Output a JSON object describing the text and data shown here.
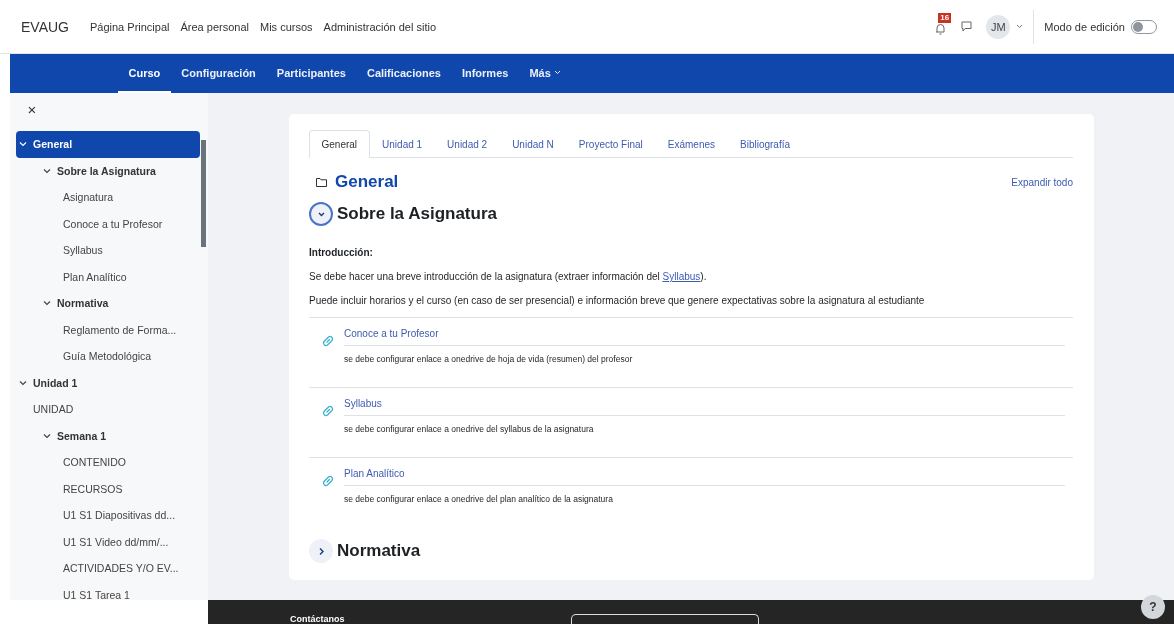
{
  "header": {
    "brand": "EVAUG",
    "links": [
      {
        "label": "Página Principal"
      },
      {
        "label": "Área personal"
      },
      {
        "label": "Mis cursos"
      },
      {
        "label": "Administración del sitio"
      }
    ],
    "notification_count": "16",
    "user_initials": "JM",
    "edit_mode": {
      "label": "Modo de edición",
      "on": false
    }
  },
  "course_nav": {
    "tabs": [
      {
        "label": "Curso",
        "selected": true
      },
      {
        "label": "Configuración",
        "selected": false
      },
      {
        "label": "Participantes",
        "selected": false
      },
      {
        "label": "Calificaciones",
        "selected": false
      },
      {
        "label": "Informes",
        "selected": false
      },
      {
        "label": "Más",
        "selected": false
      }
    ]
  },
  "sidebar": {
    "close": "×",
    "items": [
      {
        "label": "General",
        "selected": true,
        "expanded": true,
        "children": [
          {
            "label": "Sobre la Asignatura",
            "selected": false,
            "expanded": true,
            "children": [
              {
                "label": "Asignatura",
                "selected": false
              },
              {
                "label": "Conoce a tu Profesor",
                "selected": false
              },
              {
                "label": "Syllabus",
                "selected": false
              },
              {
                "label": "Plan Analítico",
                "selected": false
              }
            ]
          },
          {
            "label": "Normativa",
            "selected": false,
            "expanded": true,
            "children": [
              {
                "label": "Reglamento de Forma...",
                "selected": false
              },
              {
                "label": "Guía Metodológica",
                "selected": false
              }
            ]
          }
        ]
      },
      {
        "label": "Unidad 1",
        "selected": false,
        "expanded": true,
        "children": [
          {
            "label": "UNIDAD",
            "selected": false
          },
          {
            "label": "Semana 1",
            "selected": false,
            "expanded": true,
            "children": [
              {
                "label": "CONTENIDO",
                "selected": false
              },
              {
                "label": "RECURSOS",
                "selected": false
              },
              {
                "label": "U1 S1 Diapositivas dd...",
                "selected": false
              },
              {
                "label": "U1 S1 Video dd/mm/...",
                "selected": false
              },
              {
                "label": "ACTIVIDADES Y/O EV...",
                "selected": false
              },
              {
                "label": "U1 S1 Tarea 1",
                "selected": false
              }
            ]
          }
        ]
      }
    ]
  },
  "content": {
    "tabs": [
      {
        "label": "General",
        "selected": true
      },
      {
        "label": "Unidad 1",
        "selected": false
      },
      {
        "label": "Unidad 2",
        "selected": false
      },
      {
        "label": "Unidad N",
        "selected": false
      },
      {
        "label": "Proyecto Final",
        "selected": false
      },
      {
        "label": "Exámenes",
        "selected": false
      },
      {
        "label": "Bibliografía",
        "selected": false
      }
    ],
    "section_title": "General",
    "expand_all": "Expandir todo",
    "subsections": [
      {
        "title": "Sobre la Asignatura",
        "expanded": true,
        "intro_heading": "Introducción:",
        "paragraphs": [
          {
            "before": "Se debe hacer una breve introducción de la asignatura (extraer información del ",
            "link": "Syllabus",
            "after": ")."
          },
          {
            "before": "Puede incluir horarios y el curso (en caso de ser presencial) e información breve que genere expectativas sobre la asignatura al estudiante"
          }
        ],
        "activities": [
          {
            "title": "Conoce a tu Profesor",
            "description": "se debe configurar enlace a onedrive de  hoja de vida (resumen) del profesor"
          },
          {
            "title": "Syllabus",
            "description": "se debe configurar enlace a onedrive del syllabus de la asignatura"
          },
          {
            "title": "Plan Analítico",
            "description": "se debe configurar enlace a onedrive del plan analítico de la asignatura"
          }
        ]
      },
      {
        "title": "Normativa",
        "expanded": false
      }
    ]
  },
  "footer": {
    "heading": "Contáctanos",
    "help": "?"
  }
}
